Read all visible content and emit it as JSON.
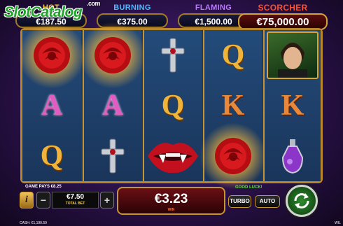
{
  "watermark": {
    "name": "SlotCatalog",
    "suffix": ".com"
  },
  "jackpots": [
    {
      "id": "hot",
      "label": "HOT",
      "value": "€187.50"
    },
    {
      "id": "burning",
      "label": "BURNING",
      "value": "€375.00"
    },
    {
      "id": "flaming",
      "label": "FLAMING",
      "value": "€1,500.00"
    },
    {
      "id": "scorcher",
      "label": "SCORCHER",
      "value": "€75,000.00"
    }
  ],
  "reels": [
    [
      "rose-wild",
      "A",
      "Q"
    ],
    [
      "rose-wild",
      "A",
      "cross-pendant"
    ],
    [
      "cross-pendant",
      "Q",
      "vampire-lips"
    ],
    [
      "Q",
      "K",
      "rose-wild"
    ],
    [
      "vampire-portrait",
      "K",
      "potion-bottle"
    ]
  ],
  "colors": {
    "hot": "#f7c93a",
    "burning": "#4fb7ff",
    "flaming": "#b97bff",
    "scorcher": "#ff5030",
    "spin_green": "#2f8a2e",
    "gold_trim": "#c8962e"
  },
  "bottom": {
    "game_pays": "GAME PAYS €8.25",
    "good_luck": "GOOD LUCK!",
    "info_label": "i",
    "minus_label": "−",
    "plus_label": "+",
    "total_bet_value": "€7.50",
    "total_bet_label": "TOTAL BET",
    "win_value": "€3.23",
    "win_label": "WIN",
    "turbo_label": "TURBO",
    "auto_label": "AUTO",
    "cash_text": "CASH: €1,190.50",
    "corner_text": "WIL"
  }
}
